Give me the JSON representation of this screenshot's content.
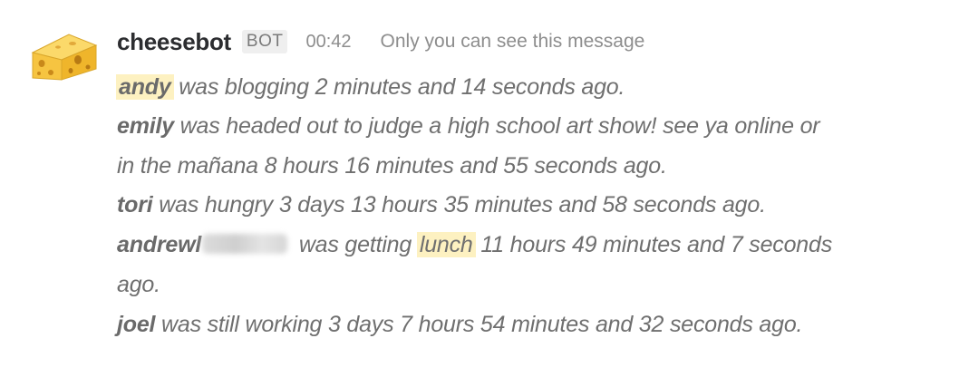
{
  "message": {
    "sender": "cheesebot",
    "badge": "BOT",
    "time": "00:42",
    "visibility": "Only you can see this message",
    "avatar_icon": "cheese-icon",
    "colors": {
      "highlight": "#fdf1c1",
      "cheese": "#f6c441"
    },
    "lines": [
      {
        "name": "andy",
        "text": " was blogging 2 minutes and 14 seconds ago."
      },
      {
        "name": "emily",
        "text": " was headed out to judge a high school art show! see ya online or"
      },
      {
        "text": "in the mañana 8 hours 16 minutes and 55 seconds ago."
      },
      {
        "name": "tori",
        "text": " was hungry 3 days 13 hours 35 minutes and 58 seconds ago."
      },
      {
        "name": "andrewl",
        "text_before": " was getting ",
        "highlight": "lunch",
        "text_after": " 11 hours 49 minutes and 7 seconds"
      },
      {
        "text": "ago."
      },
      {
        "name": "joel",
        "text": " was still working 3 days 7 hours 54 minutes and 32 seconds ago."
      }
    ]
  }
}
